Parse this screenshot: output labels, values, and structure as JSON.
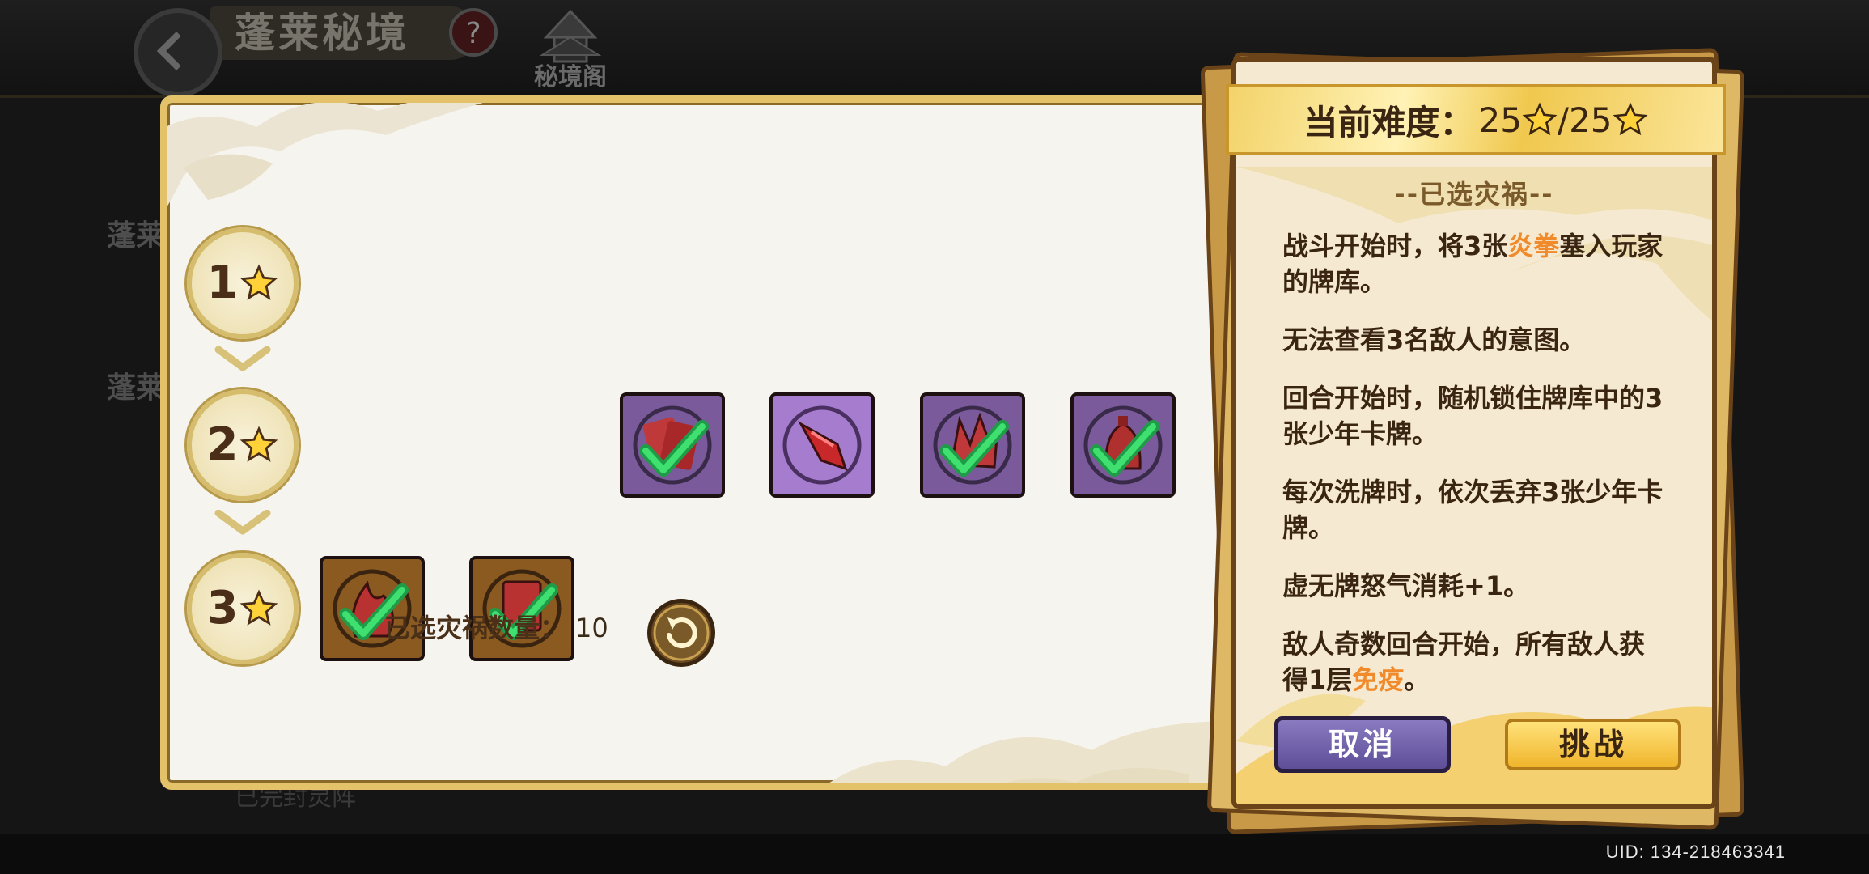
{
  "background": {
    "screen_title": "蓬莱秘境",
    "help_icon_text": "?",
    "pavilion_label": "秘境阁",
    "side_text_1": "蓬莱",
    "side_text_2": "蓬莱",
    "stage_bottom_text": "已完封灵阵"
  },
  "tiers": [
    {
      "level": "1"
    },
    {
      "level": "2"
    },
    {
      "level": "3"
    }
  ],
  "selected_count": {
    "label": "已选灾祸数量：",
    "value": "10"
  },
  "card": {
    "difficulty_label": "当前难度：",
    "difficulty_current": "25",
    "difficulty_sep": "/",
    "difficulty_max": "25",
    "section_title": "--已选灾祸--",
    "curses": [
      {
        "before": "战斗开始时，将3张",
        "keyword": "炎拳",
        "after": "塞入玩家的牌库。"
      },
      {
        "before": "无法查看3名敌人的意图。",
        "keyword": "",
        "after": ""
      },
      {
        "before": "回合开始时，随机锁住牌库中的3张少年卡牌。",
        "keyword": "",
        "after": ""
      },
      {
        "before": "每次洗牌时，依次丢弃3张少年卡牌。",
        "keyword": "",
        "after": ""
      },
      {
        "before": "虚无牌怒气消耗+1。",
        "keyword": "",
        "after": ""
      },
      {
        "before": "敌人奇数回合开始，所有敌人获得1层",
        "keyword": "免疫",
        "after": "。"
      }
    ],
    "cancel_label": "取消",
    "challenge_label": "挑战"
  },
  "uid": "UID:  134-218463341",
  "colors": {
    "panel_border": "#e4c26a",
    "keyword": "#f08a2a",
    "cancel_button": "#6e5ea8",
    "challenge_button": "#f5c63c",
    "tier2_icons": "#7a5a9a",
    "tier3_icons": "#8a5a20",
    "checkmark": "#2fcc55"
  },
  "icons": [
    "back-arrow-icon",
    "help-icon",
    "pavilion-icon",
    "star-icon",
    "chevron-down-icon",
    "curse-icon",
    "checkmark-icon",
    "reset-icon"
  ]
}
